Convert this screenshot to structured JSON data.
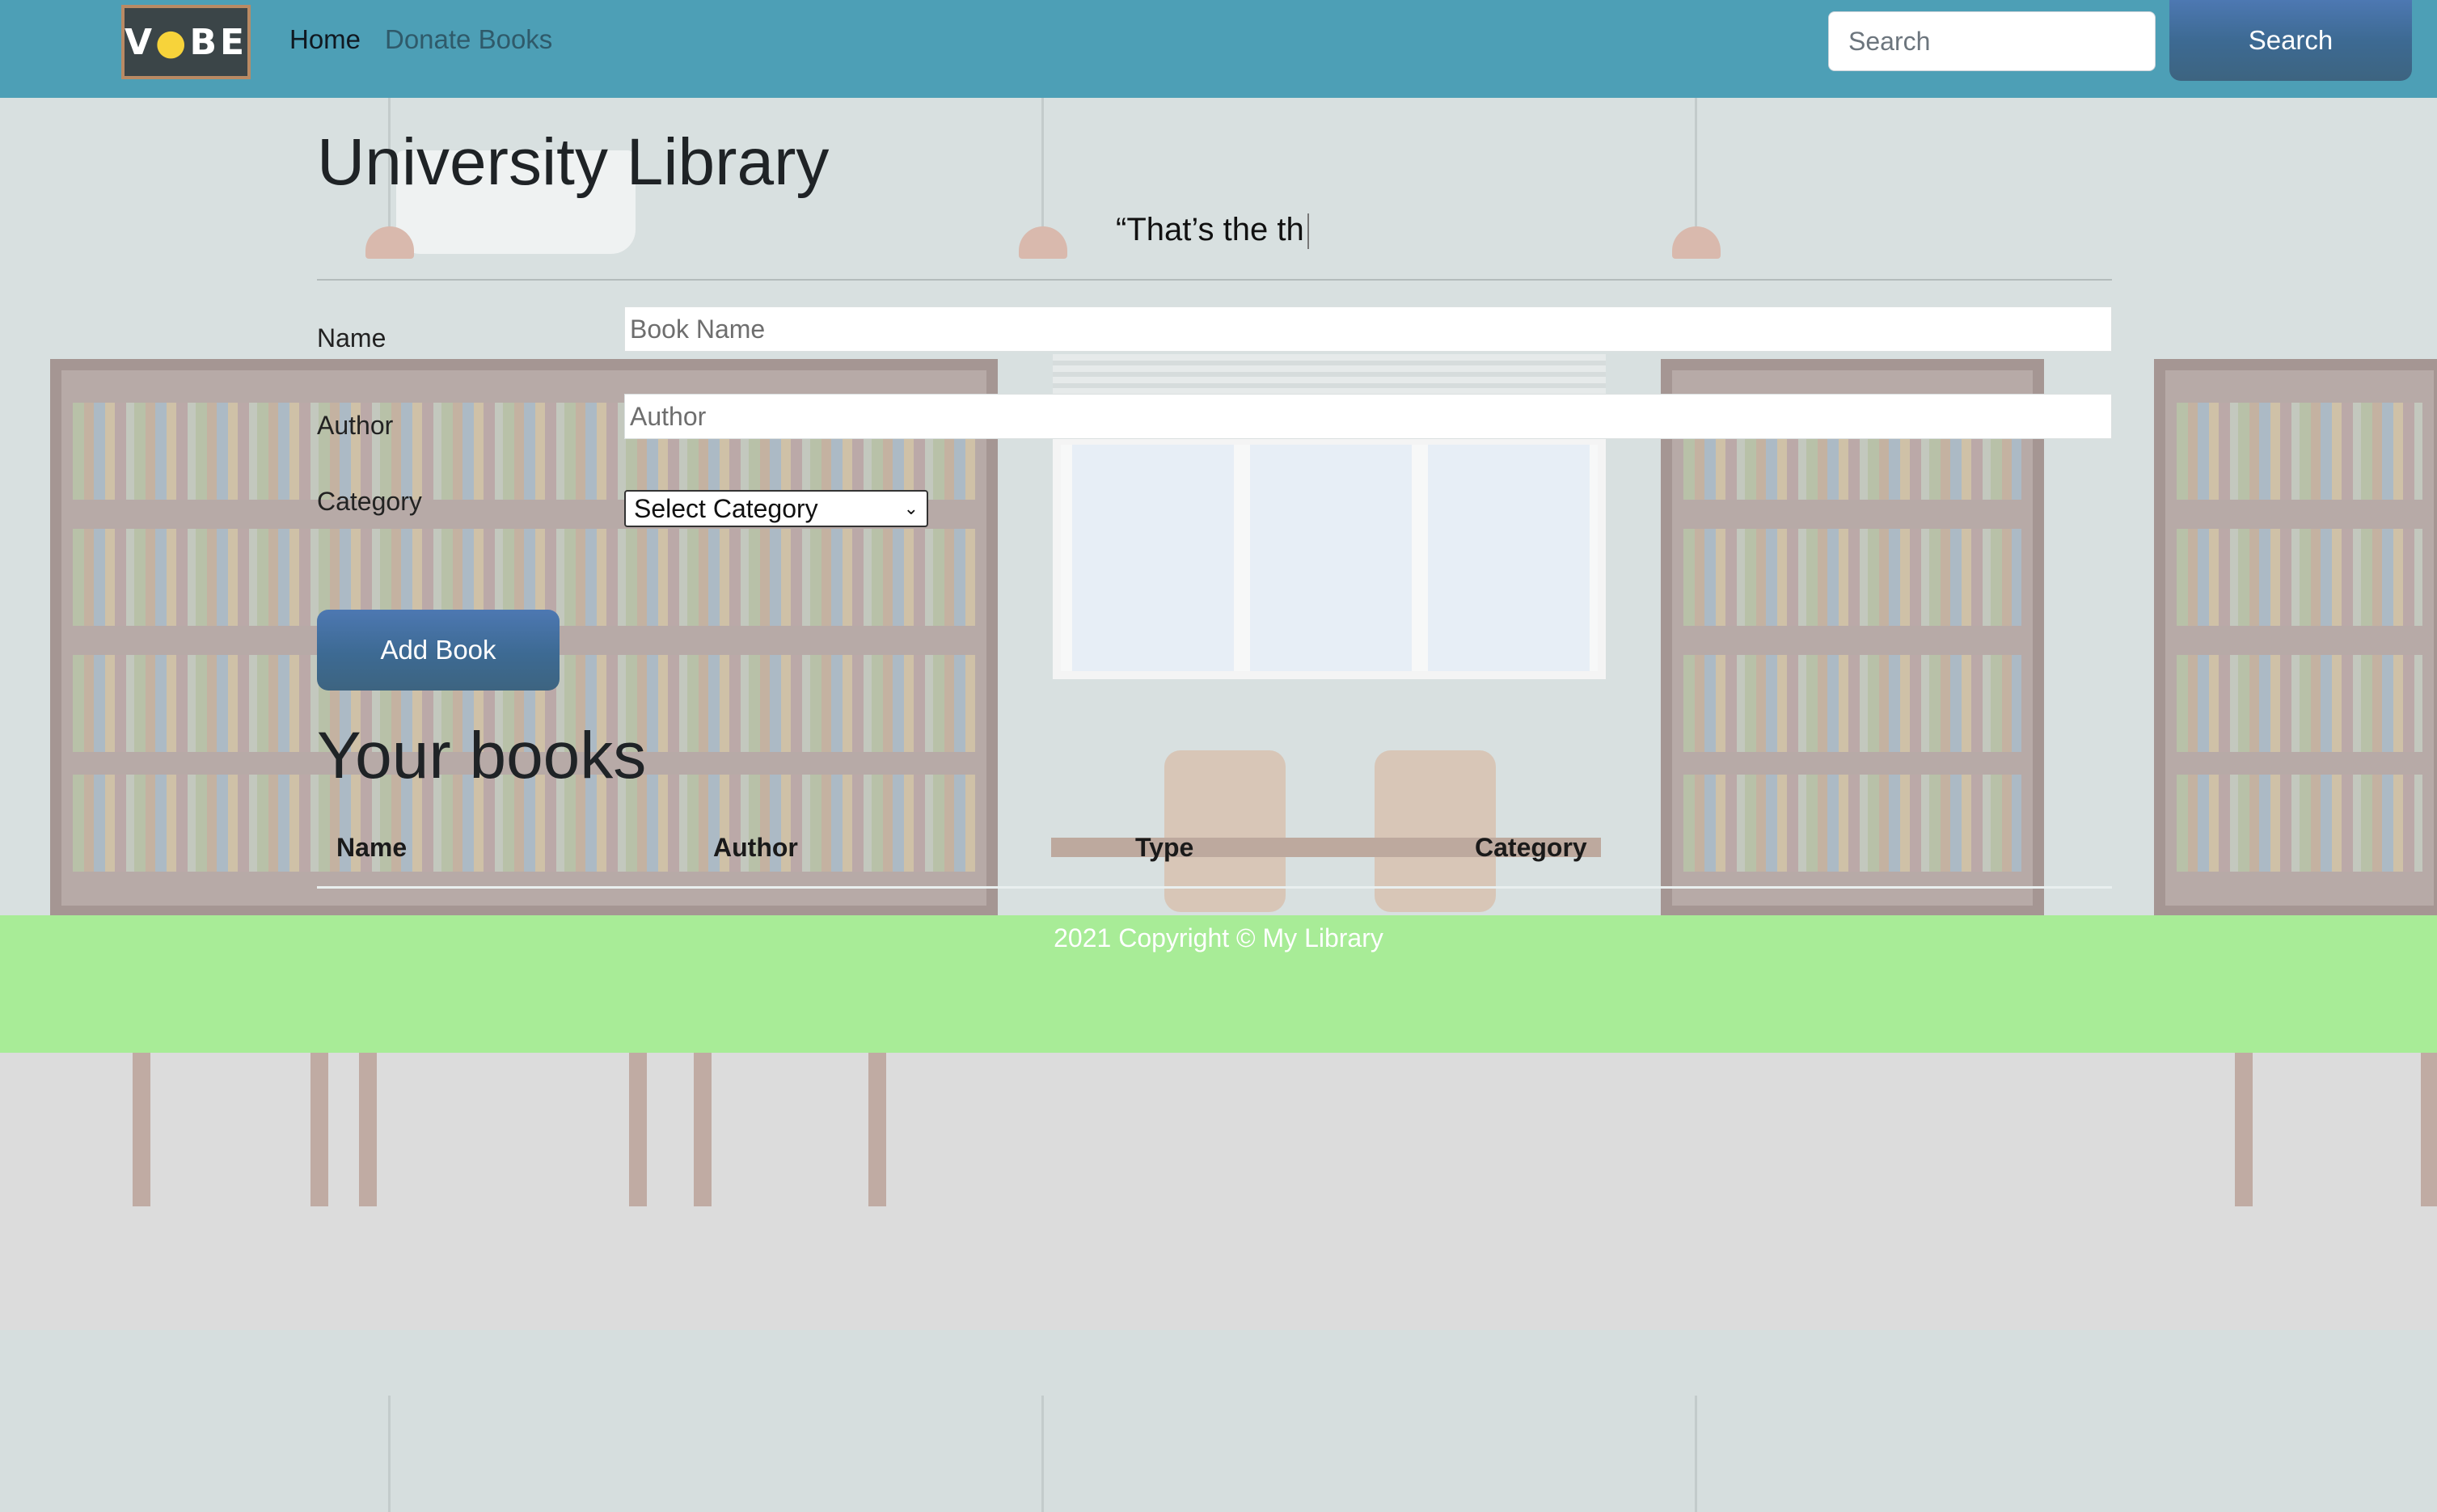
{
  "nav": {
    "logo_text": "VIBE",
    "links": [
      "Home",
      "Donate Books"
    ],
    "search_placeholder": "Search",
    "search_button": "Search"
  },
  "page": {
    "title": "University Library",
    "quote": "“That’s the th"
  },
  "form": {
    "name_label": "Name",
    "name_placeholder": "Book Name",
    "author_label": "Author",
    "author_placeholder": "Author",
    "category_label": "Category",
    "category_selected": "Select Category",
    "add_button": "Add Book"
  },
  "books": {
    "heading": "Your books",
    "columns": [
      "Name",
      "Author",
      "Type",
      "Category"
    ]
  },
  "footer": {
    "text": "2021 Copyright © My Library"
  },
  "colors": {
    "navbar": "#4d9fb6",
    "button": "#4d78b2",
    "footer": "#a8ec97"
  }
}
